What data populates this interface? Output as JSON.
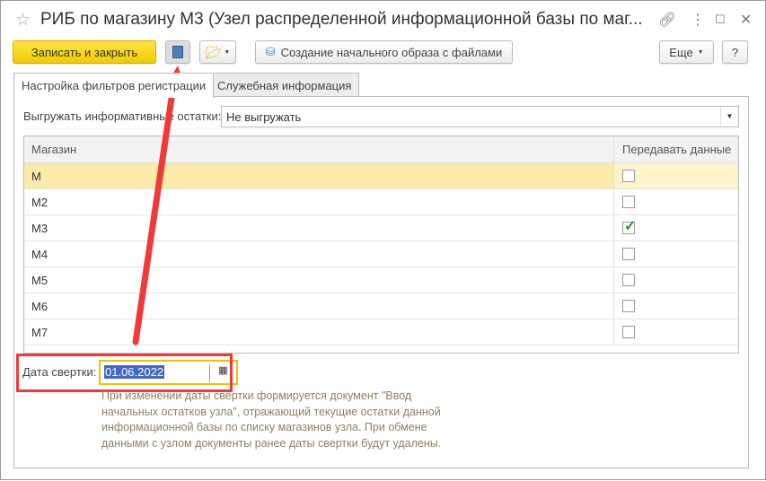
{
  "window": {
    "title": "РИБ по магазину М3 (Узел распределенной информационной базы по маг..."
  },
  "toolbar": {
    "save_close": "Записать и закрыть",
    "create_image": "Создание начального образа с файлами",
    "more": "Еще",
    "help": "?"
  },
  "tabs": [
    {
      "label": "Настройка фильтров регистрации"
    },
    {
      "label": "Служебная информация"
    }
  ],
  "export_balances": {
    "label": "Выгружать информативные остатки:",
    "value": "Не выгружать"
  },
  "table": {
    "headers": [
      "Магазин",
      "Передавать данные"
    ],
    "rows": [
      {
        "name": "М",
        "checked": false
      },
      {
        "name": "М2",
        "checked": false
      },
      {
        "name": "М3",
        "checked": true
      },
      {
        "name": "М4",
        "checked": false
      },
      {
        "name": "М5",
        "checked": false
      },
      {
        "name": "М6",
        "checked": false
      },
      {
        "name": "М7",
        "checked": false
      }
    ]
  },
  "rollup": {
    "label": "Дата свертки:",
    "value": "01.06.2022",
    "note": "При изменении даты свертки формируется документ \"Ввод начальных остатков узла\", отражающий текущие остатки данной информационной базы по списку магазинов узла. При обмене данными с узлом документы ранее даты свертки будут удалены."
  },
  "colors": {
    "primary": "#f2cc00",
    "annotation": "#f03a3a",
    "focus": "#f1c200"
  }
}
